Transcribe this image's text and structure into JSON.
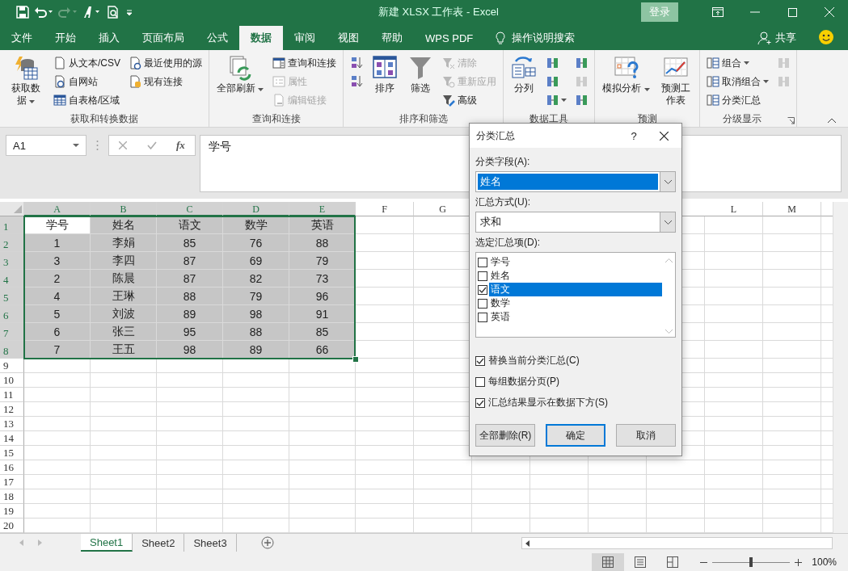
{
  "window": {
    "title": "新建 XLSX 工作表 - Excel",
    "sign_in": "登录"
  },
  "tabs": [
    {
      "label": "文件",
      "selected": false
    },
    {
      "label": "开始",
      "selected": false
    },
    {
      "label": "插入",
      "selected": false
    },
    {
      "label": "页面布局",
      "selected": false
    },
    {
      "label": "公式",
      "selected": false
    },
    {
      "label": "数据",
      "selected": true
    },
    {
      "label": "审阅",
      "selected": false
    },
    {
      "label": "视图",
      "selected": false
    },
    {
      "label": "帮助",
      "selected": false
    },
    {
      "label": "WPS PDF",
      "selected": false
    }
  ],
  "tell_me": "操作说明搜索",
  "share": "共享",
  "ribbon": {
    "groups": [
      {
        "label": "获取和转换数据",
        "columns": [
          {
            "kind": "large",
            "label": "获取数据",
            "caret": true,
            "disabled": false
          },
          {
            "kind": "stack",
            "items": [
              {
                "label": "从文本/CSV",
                "disabled": false,
                "caret": false
              },
              {
                "label": "自网站",
                "disabled": false,
                "caret": false
              },
              {
                "label": "自表格/区域",
                "disabled": false,
                "caret": false
              }
            ]
          },
          {
            "kind": "stack",
            "items": [
              {
                "label": "最近使用的源",
                "disabled": false,
                "caret": false
              },
              {
                "label": "现有连接",
                "disabled": false,
                "caret": false
              }
            ]
          }
        ]
      },
      {
        "label": "查询和连接",
        "columns": [
          {
            "kind": "large",
            "label": "全部刷新",
            "caret": true,
            "disabled": false
          },
          {
            "kind": "stack",
            "items": [
              {
                "label": "查询和连接",
                "disabled": false,
                "caret": false
              },
              {
                "label": "属性",
                "disabled": true,
                "caret": false
              },
              {
                "label": "编辑链接",
                "disabled": true,
                "caret": false
              }
            ]
          }
        ]
      },
      {
        "label": "排序和筛选",
        "columns": [
          {
            "kind": "stack",
            "items": [
              {
                "disabled": false,
                "caret": false
              },
              {
                "disabled": false,
                "caret": false
              }
            ]
          },
          {
            "kind": "large",
            "label": "排序",
            "caret": false,
            "disabled": false
          },
          {
            "kind": "large",
            "label": "筛选",
            "caret": false,
            "disabled": false
          },
          {
            "kind": "stack",
            "items": [
              {
                "label": "清除",
                "disabled": true,
                "caret": false
              },
              {
                "label": "重新应用",
                "disabled": true,
                "caret": false
              },
              {
                "label": "高级",
                "disabled": false,
                "caret": false
              }
            ]
          }
        ]
      },
      {
        "label": "数据工具",
        "columns": [
          {
            "kind": "large",
            "label": "分列",
            "caret": false,
            "disabled": false
          },
          {
            "kind": "stack",
            "items": [
              {
                "disabled": false,
                "caret": false
              },
              {
                "disabled": false,
                "caret": false
              },
              {
                "disabled": false,
                "caret": true
              }
            ]
          },
          {
            "kind": "stack",
            "items": [
              {
                "disabled": false,
                "caret": false
              },
              {
                "disabled": true,
                "caret": false
              },
              {
                "disabled": false,
                "caret": false
              }
            ]
          }
        ]
      },
      {
        "label": "预测",
        "columns": [
          {
            "kind": "large",
            "label": "模拟分析",
            "caret": true,
            "disabled": false
          },
          {
            "kind": "large",
            "label": "预测工作表",
            "caret": false,
            "disabled": false
          }
        ]
      },
      {
        "label": "分级显示",
        "launcher": true,
        "columns": [
          {
            "kind": "stack",
            "items": [
              {
                "label": "组合",
                "disabled": false,
                "caret": true
              },
              {
                "label": "取消组合",
                "disabled": false,
                "caret": true
              },
              {
                "label": "分类汇总",
                "disabled": false,
                "caret": false
              }
            ]
          },
          {
            "kind": "stack",
            "items": [
              {
                "disabled": true,
                "caret": false
              },
              {
                "disabled": true,
                "caret": false
              }
            ]
          }
        ]
      }
    ]
  },
  "formula_bar": {
    "name_box": "A1",
    "fx": "fx",
    "formula": "学号"
  },
  "sheet": {
    "columns": [
      {
        "label": "A",
        "selected": true
      },
      {
        "label": "B",
        "selected": true
      },
      {
        "label": "C",
        "selected": true
      },
      {
        "label": "D",
        "selected": true
      },
      {
        "label": "E",
        "selected": true
      },
      {
        "label": "F",
        "selected": false
      },
      {
        "label": "G",
        "selected": false
      },
      {
        "label": "L",
        "selected": false
      },
      {
        "label": "M",
        "selected": false
      }
    ],
    "rows": [
      {
        "label": "1",
        "selected": true,
        "cells": [
          {
            "text": "学号",
            "highlighted": false
          },
          {
            "text": "姓名",
            "highlighted": true
          },
          {
            "text": "语文",
            "highlighted": true
          },
          {
            "text": "数学",
            "highlighted": true
          },
          {
            "text": "英语",
            "highlighted": true
          }
        ]
      },
      {
        "label": "2",
        "selected": true,
        "cells": [
          {
            "text": "1",
            "highlighted": true
          },
          {
            "text": "李娟",
            "highlighted": true
          },
          {
            "text": "85",
            "highlighted": true
          },
          {
            "text": "76",
            "highlighted": true
          },
          {
            "text": "88",
            "highlighted": true
          }
        ]
      },
      {
        "label": "3",
        "selected": true,
        "cells": [
          {
            "text": "3",
            "highlighted": true
          },
          {
            "text": "李四",
            "highlighted": true
          },
          {
            "text": "87",
            "highlighted": true
          },
          {
            "text": "69",
            "highlighted": true
          },
          {
            "text": "79",
            "highlighted": true
          }
        ]
      },
      {
        "label": "4",
        "selected": true,
        "cells": [
          {
            "text": "2",
            "highlighted": true
          },
          {
            "text": "陈晨",
            "highlighted": true
          },
          {
            "text": "87",
            "highlighted": true
          },
          {
            "text": "82",
            "highlighted": true
          },
          {
            "text": "73",
            "highlighted": true
          }
        ]
      },
      {
        "label": "5",
        "selected": true,
        "cells": [
          {
            "text": "4",
            "highlighted": true
          },
          {
            "text": "王琳",
            "highlighted": true
          },
          {
            "text": "88",
            "highlighted": true
          },
          {
            "text": "79",
            "highlighted": true
          },
          {
            "text": "96",
            "highlighted": true
          }
        ]
      },
      {
        "label": "6",
        "selected": true,
        "cells": [
          {
            "text": "5",
            "highlighted": true
          },
          {
            "text": "刘波",
            "highlighted": true
          },
          {
            "text": "89",
            "highlighted": true
          },
          {
            "text": "98",
            "highlighted": true
          },
          {
            "text": "91",
            "highlighted": true
          }
        ]
      },
      {
        "label": "7",
        "selected": true,
        "cells": [
          {
            "text": "6",
            "highlighted": true
          },
          {
            "text": "张三",
            "highlighted": true
          },
          {
            "text": "95",
            "highlighted": true
          },
          {
            "text": "88",
            "highlighted": true
          },
          {
            "text": "85",
            "highlighted": true
          }
        ]
      },
      {
        "label": "8",
        "selected": true,
        "cells": [
          {
            "text": "7",
            "highlighted": true
          },
          {
            "text": "王五",
            "highlighted": true
          },
          {
            "text": "98",
            "highlighted": true
          },
          {
            "text": "89",
            "highlighted": true
          },
          {
            "text": "66",
            "highlighted": true
          }
        ]
      },
      {
        "label": "9",
        "selected": false
      },
      {
        "label": "10",
        "selected": false
      },
      {
        "label": "11",
        "selected": false
      },
      {
        "label": "12",
        "selected": false
      },
      {
        "label": "13",
        "selected": false
      },
      {
        "label": "14",
        "selected": false
      },
      {
        "label": "15",
        "selected": false
      },
      {
        "label": "16",
        "selected": false
      },
      {
        "label": "17",
        "selected": false
      },
      {
        "label": "18",
        "selected": false
      },
      {
        "label": "19",
        "selected": false
      },
      {
        "label": "20",
        "selected": false
      }
    ]
  },
  "sheet_tabs": [
    {
      "label": "Sheet1",
      "selected": true
    },
    {
      "label": "Sheet2",
      "selected": false
    },
    {
      "label": "Sheet3",
      "selected": false
    }
  ],
  "status_bar": {
    "views": [
      {
        "selected": true
      },
      {
        "selected": false
      },
      {
        "selected": false
      }
    ],
    "zoom": {
      "level": 0.5,
      "reading": "100%"
    }
  },
  "dialog": {
    "title": "分类汇总",
    "help": "?",
    "group_by": {
      "label": "分类字段(A):",
      "value": "姓名",
      "highlighted": true
    },
    "function": {
      "label": "汇总方式(U):",
      "value": "求和",
      "highlighted": false
    },
    "subtotal_label": "选定汇总项(D):",
    "subtotal_items": [
      {
        "label": "学号",
        "checked": false,
        "selected": false
      },
      {
        "label": "姓名",
        "checked": false,
        "selected": false
      },
      {
        "label": "语文",
        "checked": true,
        "selected": true
      },
      {
        "label": "数学",
        "checked": false,
        "selected": false
      },
      {
        "label": "英语",
        "checked": false,
        "selected": false
      }
    ],
    "options": [
      {
        "label": "替换当前分类汇总(C)",
        "checked": true
      },
      {
        "label": "每组数据分页(P)",
        "checked": false
      },
      {
        "label": "汇总结果显示在数据下方(S)",
        "checked": true
      }
    ],
    "buttons": [
      {
        "label": "全部删除(R)",
        "default": false
      },
      {
        "label": "确定",
        "default": true
      },
      {
        "label": "取消",
        "default": false
      }
    ]
  }
}
